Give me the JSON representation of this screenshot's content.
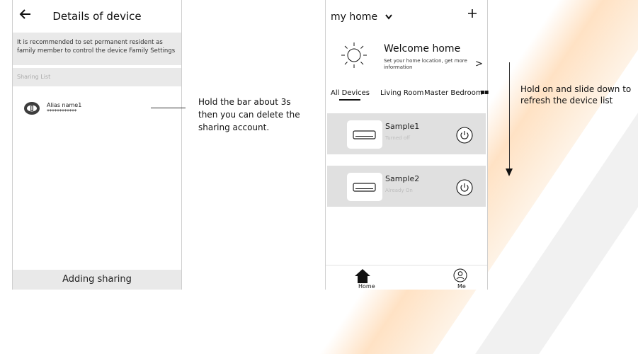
{
  "left_screen": {
    "title": "Details of device",
    "notice": "It is recommended to set permanent resident as family member to control the device  Family Settings",
    "sharing_list_label": "Sharing List",
    "sharing_items": [
      {
        "alias": "Alias name1",
        "masked": "************"
      }
    ],
    "footer_button": "Adding sharing"
  },
  "left_callout": "Hold the bar about 3s then you can delete the sharing account.",
  "right_screen": {
    "home_label": "my home",
    "welcome_title": "Welcome home",
    "welcome_subtitle": "Set your home location, get more information",
    "welcome_chevron": ">",
    "tabs": [
      {
        "label": "All Devices"
      },
      {
        "label": "Living Room"
      },
      {
        "label": "Master Bedroom"
      }
    ],
    "devices": [
      {
        "name": "Sample1",
        "status": "Turned off"
      },
      {
        "name": "Sample2",
        "status": "Already On"
      }
    ],
    "nav": {
      "home": "Home",
      "me": "Me"
    }
  },
  "right_callout": "Hold on and slide down to refresh the device list",
  "icons": {
    "back": "back-arrow-icon",
    "dropdown": "chevron-down-icon",
    "add": "plus-icon",
    "weather": "sun-icon",
    "device": "air-conditioner-icon",
    "power": "power-icon",
    "home": "home-icon",
    "me": "user-icon"
  },
  "colors": {
    "card_bg": "#e0e0e0",
    "notice_bg": "#e9e9e9",
    "accent_stripe": "#ffd9b8",
    "status_text": "#bdbdbd"
  }
}
